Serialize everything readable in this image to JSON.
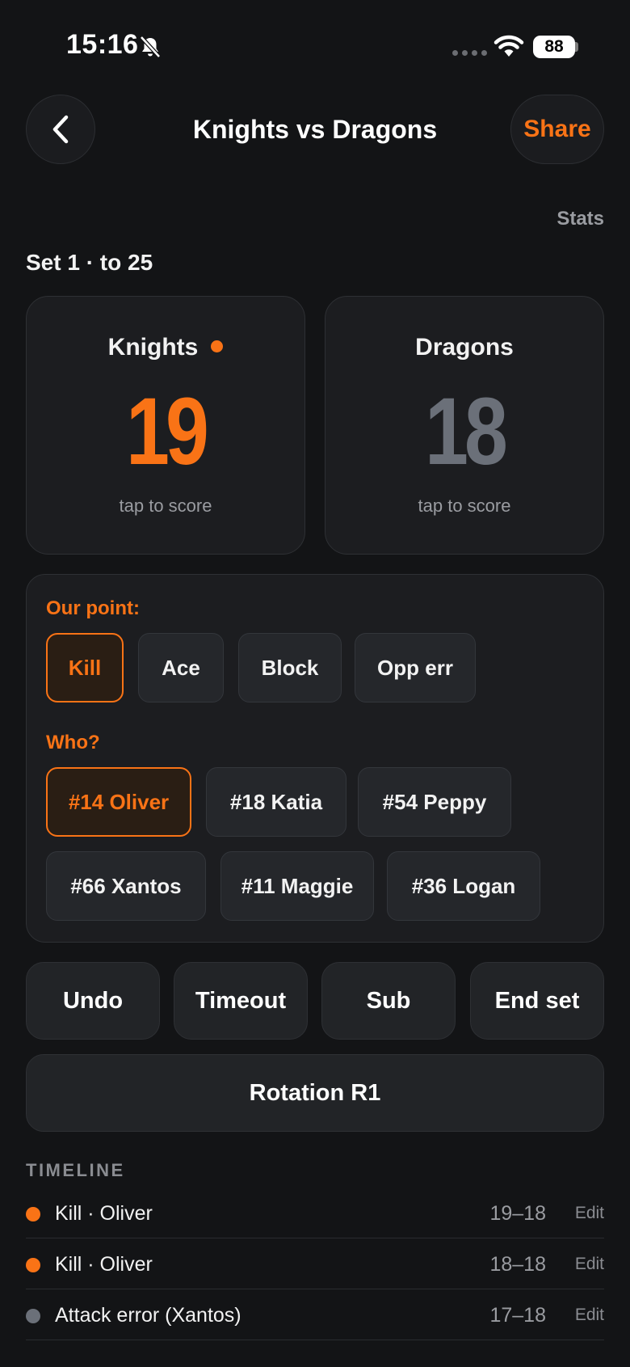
{
  "status": {
    "time": "15:16",
    "battery": "88"
  },
  "nav": {
    "title": "Knights vs Dragons",
    "share_label": "Share"
  },
  "stats_label": "Stats",
  "set_label": "Set 1 · to 25",
  "teams": [
    {
      "name": "Knights",
      "score": "19",
      "hint": "tap to score",
      "serving": true,
      "color": "#f97316"
    },
    {
      "name": "Dragons",
      "score": "18",
      "hint": "tap to score",
      "serving": false,
      "color": "#6b7079"
    }
  ],
  "point_panel": {
    "our_point_label": "Our point:",
    "point_types": [
      "Kill",
      "Ace",
      "Block",
      "Opp err"
    ],
    "selected_point_type": "Kill",
    "who_label": "Who?",
    "players": [
      "#14 Oliver",
      "#18 Katia",
      "#54 Peppy",
      "#66 Xantos",
      "#11 Maggie",
      "#36 Logan"
    ],
    "selected_player": "#14 Oliver"
  },
  "actions": [
    "Undo",
    "Timeout",
    "Sub",
    "End set"
  ],
  "rotation_label": "Rotation R1",
  "timeline": {
    "heading": "TIMELINE",
    "edit_label": "Edit",
    "events": [
      {
        "text": "Kill · Oliver",
        "score": "19–18",
        "dot": "#f97316"
      },
      {
        "text": "Kill · Oliver",
        "score": "18–18",
        "dot": "#f97316"
      },
      {
        "text": "Attack error (Xantos)",
        "score": "17–18",
        "dot": "#6b7079"
      }
    ]
  },
  "colors": {
    "accent": "#f97316",
    "background": "#131416",
    "card": "#1c1d20"
  }
}
